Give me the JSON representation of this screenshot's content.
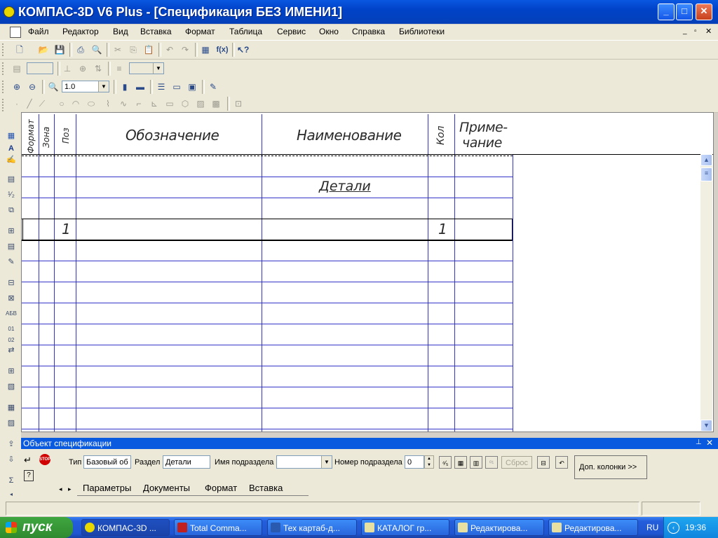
{
  "window": {
    "title": "КОМПАС-3D V6 Plus - [Спецификация БЕЗ ИМЕНИ1]",
    "min_icon": "minimize-icon",
    "max_icon": "maximize-icon",
    "close_icon": "close-icon"
  },
  "menu": [
    "Файл",
    "Редактор",
    "Вид",
    "Вставка",
    "Формат",
    "Таблица",
    "Сервис",
    "Окно",
    "Справка",
    "Библиотеки"
  ],
  "toolbar": {
    "scale_value": "1.0"
  },
  "spec_table": {
    "headers": {
      "format": "Формат",
      "zone": "Зона",
      "pos": "Поз",
      "designation": "Обозначение",
      "name": "Наименование",
      "qty": "Кол",
      "note_line1": "Приме-",
      "note_line2": "чание"
    },
    "section_title": "Детали",
    "row": {
      "pos": "1",
      "qty": "1"
    }
  },
  "panel": {
    "title": "Объект спецификации",
    "type_label": "Тип",
    "type_value": "Базовый об",
    "section_label": "Раздел",
    "section_value": "Детали",
    "subsection_name_label": "Имя подраздела",
    "subsection_name_value": "",
    "subsection_number_label": "Номер подраздела",
    "subsection_number_value": "0",
    "reset_label": "Сброс",
    "extra_columns_label": "Доп. колонки  >>",
    "tabs": [
      "Параметры",
      "Документы",
      "Формат",
      "Вставка"
    ]
  },
  "taskbar": {
    "start_label": "пуск",
    "items": [
      "КОМПАС-3D ...",
      "Total Comma...",
      "Тех картаб-д...",
      "КАТАЛОГ гр...",
      "Редактирова...",
      "Редактирова..."
    ],
    "lang": "RU",
    "clock": "19:36"
  },
  "colors": {
    "title_blue": "#0a58e0",
    "grid_blue": "#3434c8",
    "start_green": "#3fa63f"
  }
}
